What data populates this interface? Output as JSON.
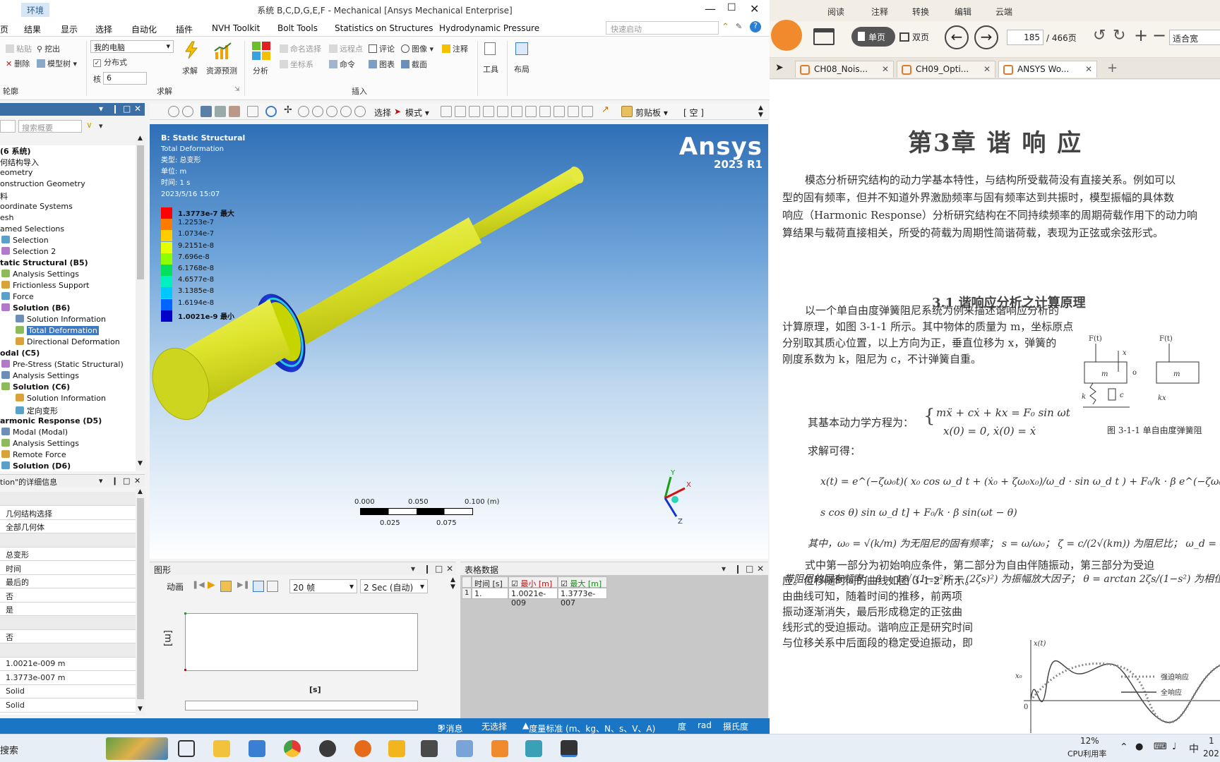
{
  "mechanical": {
    "context_tab": "环境",
    "window_title": "系统 B,C,D,G,E,F - Mechanical [Ansys Mechanical Enterprise]",
    "ribbon_tabs": [
      "页",
      "结果",
      "显示",
      "选择",
      "自动化",
      "插件",
      "NVH Toolkit",
      "Bolt Tools",
      "Statistics on Structures",
      "Hydrodynamic Pressure"
    ],
    "quick_launch_placeholder": "快速启动",
    "ribbon": {
      "paste": "粘贴",
      "cut": "挖出",
      "delete": "删除",
      "model_tree": "模型树",
      "outline_group": "轮廓",
      "computer_select": "我的电脑",
      "distributed": "分布式",
      "cores_label": "核",
      "cores_value": "6",
      "solve": "求解",
      "resource_prediction": "资源预测",
      "solve_group": "求解",
      "analysis": "分析",
      "named_selection": "命名选择",
      "remote_point": "远程点",
      "comment": "评论",
      "image": "图像",
      "annotation": "注释",
      "coordinate_system": "坐标系",
      "command": "命令",
      "chart": "图表",
      "section": "截面",
      "insert_group": "插入",
      "tools": "工具",
      "layout": "布局"
    },
    "tree": {
      "search_placeholder": "搜索概要",
      "nodes": [
        {
          "label": "(6 系统)",
          "bold": true,
          "indent": 0
        },
        {
          "label": "何结构导入",
          "indent": 0
        },
        {
          "label": "eometry",
          "indent": 0
        },
        {
          "label": "onstruction Geometry",
          "indent": 0
        },
        {
          "label": "料",
          "indent": 0
        },
        {
          "label": "oordinate Systems",
          "indent": 0
        },
        {
          "label": "esh",
          "indent": 0
        },
        {
          "label": "amed Selections",
          "indent": 0
        },
        {
          "label": "Selection",
          "indent": 1
        },
        {
          "label": "Selection 2",
          "indent": 1
        },
        {
          "label": "tatic Structural (B5)",
          "bold": true,
          "indent": 0
        },
        {
          "label": "Analysis Settings",
          "indent": 1
        },
        {
          "label": "Frictionless Support",
          "indent": 1
        },
        {
          "label": "Force",
          "indent": 1
        },
        {
          "label": "Solution (B6)",
          "bold": true,
          "indent": 1
        },
        {
          "label": "Solution Information",
          "indent": 2
        },
        {
          "label": "Total Deformation",
          "indent": 2,
          "selected": true
        },
        {
          "label": "Directional Deformation",
          "indent": 2
        },
        {
          "label": "odal (C5)",
          "bold": true,
          "indent": 0
        },
        {
          "label": "Pre-Stress (Static Structural)",
          "indent": 1
        },
        {
          "label": "Analysis Settings",
          "indent": 1
        },
        {
          "label": "Solution (C6)",
          "bold": true,
          "indent": 1
        },
        {
          "label": "Solution Information",
          "indent": 2
        },
        {
          "label": "定向变形",
          "indent": 2
        },
        {
          "label": "armonic Response (D5)",
          "bold": true,
          "indent": 0
        },
        {
          "label": "Modal (Modal)",
          "indent": 1
        },
        {
          "label": "Analysis Settings",
          "indent": 1
        },
        {
          "label": "Remote Force",
          "indent": 1
        },
        {
          "label": "Solution (D6)",
          "bold": true,
          "indent": 1
        }
      ]
    },
    "details": {
      "title": "tion\"的详细信息",
      "rows": [
        "",
        "几何结构选择",
        "全部几何体",
        "",
        "总变形",
        "时间",
        "最后的",
        "否",
        "是",
        "",
        "否",
        "",
        "1.0021e-009 m",
        "1.3773e-007 m",
        "Solid",
        "Solid"
      ]
    },
    "viewport": {
      "analysis": "B: Static Structural",
      "result": "Total Deformation",
      "type": "类型: 总变形",
      "unit": "单位: m",
      "time": "时间: 1 s",
      "date": "2023/5/16 15:07",
      "logo": "Ansys",
      "version": "2023 R1",
      "legend_labels": [
        "1.3773e-7 最大",
        "1.2253e-7",
        "1.0734e-7",
        "9.2151e-8",
        "7.696e-8",
        "6.1768e-8",
        "4.6577e-8",
        "3.1385e-8",
        "1.6194e-8",
        "1.0021e-9 最小"
      ],
      "legend_colors": [
        "#ff0000",
        "#ff7a00",
        "#ffcc00",
        "#e6ff00",
        "#8cff00",
        "#00e05a",
        "#00f0c0",
        "#00c8ff",
        "#0064ff",
        "#0000c8"
      ],
      "scale_top": [
        "0.000",
        "0.050",
        "0.100 (m)"
      ],
      "scale_bottom": [
        "0.025",
        "0.075"
      ],
      "triad": [
        "Y",
        "X",
        "Z"
      ]
    },
    "toolbar2": {
      "select": "选择",
      "mode": "模式",
      "clipboard": "剪贴板",
      "empty": "[ 空 ]"
    },
    "graph_panel": {
      "title": "图形",
      "animation": "动画",
      "frames": "20 帧",
      "duration": "2 Sec (自动)",
      "y_axis": "[m]",
      "x_axis": "[s]"
    },
    "table_panel": {
      "title": "表格数据",
      "headers": [
        "时间 [s]",
        "最小 [m]",
        "最大 [m]"
      ],
      "rows": [
        [
          "1",
          "1.",
          "1.0021e-009",
          "1.3773e-007"
        ]
      ]
    },
    "status": {
      "messages": "3 消息",
      "selection": "无选择",
      "units": "度量标准 (m、kg、N、s、V、A)",
      "deg": "度",
      "rad": "rad",
      "temp": "摄氏度"
    }
  },
  "pdf": {
    "menu": [
      "阅读",
      "注释",
      "转换",
      "编辑",
      "云端"
    ],
    "single_page": "单页",
    "double_page": "双页",
    "page_current": "185",
    "page_total": "/ 466页",
    "fit": "适合宽",
    "tabs": [
      "CH08_Nois...",
      "CH09_Opti...",
      "ANSYS Wo..."
    ],
    "page": {
      "chapter": "第3章  谐  响  应",
      "para1": [
        "模态分析研究结构的动力学基本特性，与结构所受载荷没有直接关系。例如可以",
        "型的固有频率，但并不知道外界激励频率与固有频率达到共振时，模型振幅的具体数",
        "响应（Harmonic Response）分析研究结构在不同持续频率的周期荷载作用下的动力响",
        "算结果与载荷直接相关，所受的荷载为周期性简谐荷载，表现为正弦或余弦形式。"
      ],
      "section": "3.1   谐响应分析之计算原理",
      "para2": [
        "以一个单自由度弹簧阻尼系统为例来描述谐响应分析的",
        "计算原理，如图 3-1-1 所示。其中物体的质量为 m，坐标原点",
        "分别取其质心位置，以上方向为正，垂直位移为 x，弹簧的",
        "刚度系数为 k，阻尼为 c，不计弹簧自重。"
      ],
      "eq_label": "其基本动力学方程为：",
      "eq1": "mẍ + cẋ + kx = F₀ sin ωt",
      "eq2": "x(0) = 0,  ẋ(0) = ẋ",
      "solve_label": "求解可得：",
      "solution_line1": "x(t) = e^(−ζω₀t)( x₀ cos ω_d t + (ẋ₀ + ζω₀x₀)/ω_d · sin ω_d t ) + F₀/k · β e^(−ζω₀t) [sin θ cos ω_d t + ω₀/ω_d (ζ sin θ −",
      "solution_line2": "s cos θ) sin ω_d t] + F₀/k · β sin(ωt − θ)",
      "where_line": "其中，ω₀ = √(k/m) 为无阻尼的固有频率；  s = ω/ω₀；  ζ = c/(2√(km)) 为阻尼比；  ω_d = ω₀√(1",
      "beta_line": "带阻尼的固有频率；  β = 1/√((1−s²)² + (2ζs)²) 为振幅放大因子；  θ = arctan 2ζs/(1−s²) 为相位",
      "para3": [
        "式中第一部分为初始响应条件，第二部分为自由伴随振动，第三部分为受迫",
        "应。位移随时间的曲线如图 3-1-2 所示。",
        "由曲线可知，随着时间的推移，前两项",
        "振动逐渐消失，最后形成稳定的正弦曲",
        "线形式的受迫振动。谐响应正是研究时间",
        "与位移关系中后面段的稳定受迫振动，即"
      ],
      "fig_caption": "图 3-1-1    单自由度弹簧阻",
      "fig_labels": {
        "F": "F(t)",
        "x": "x",
        "m": "m",
        "o": "o",
        "k": "k",
        "c": "c",
        "kx": "kx",
        "xt": "x(t)",
        "x0": "x₀",
        "zero": "0"
      },
      "legend_forced": "强迫响应",
      "legend_total": "全响应"
    }
  },
  "taskbar": {
    "search": "搜索",
    "cpu_percent": "12%",
    "cpu_label": "CPU利用率",
    "ime": "中",
    "clock_top": "1",
    "clock_bottom": "202"
  }
}
